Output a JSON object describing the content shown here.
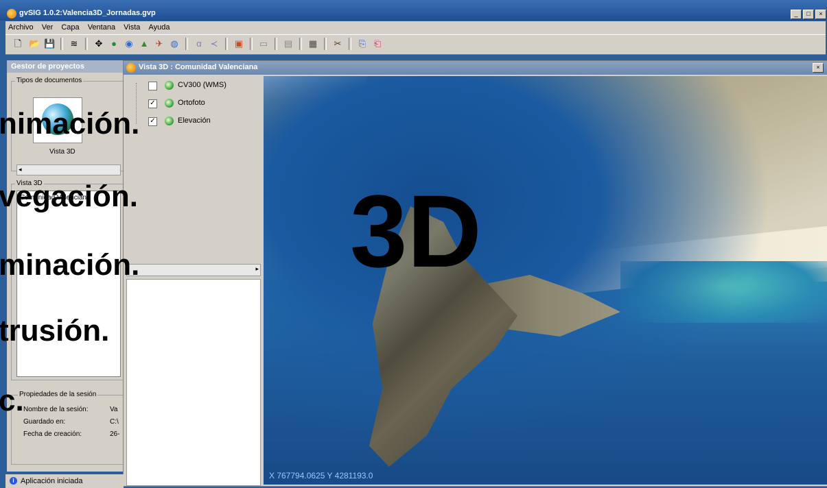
{
  "window": {
    "title": "gvSIG 1.0.2:Valencia3D_Jornadas.gvp",
    "min": "_",
    "max": "□",
    "close": "×"
  },
  "menu": [
    "Archivo",
    "Ver",
    "Capa",
    "Ventana",
    "Vista",
    "Ayuda"
  ],
  "project_manager": {
    "title": "Gestor de proyectos",
    "doc_types_label": "Tipos de documentos",
    "doc_item": "Vista 3D",
    "list_label": "Vista 3D",
    "list_item": "Comunidad Valenciana",
    "session_label": "Propiedades de la sesión",
    "session": [
      {
        "k": "Nombre de la sesión:",
        "v": "Va"
      },
      {
        "k": "Guardado en:",
        "v": "C:\\"
      },
      {
        "k": "Fecha de creación:",
        "v": "26-"
      }
    ]
  },
  "view3d": {
    "title": "Vista 3D : Comunidad Valenciana",
    "close": "×",
    "layers": [
      {
        "label": "CV300 (WMS)",
        "checked": false
      },
      {
        "label": "Ortofoto",
        "checked": true
      },
      {
        "label": "Elevación",
        "checked": true
      }
    ],
    "coords": "X  767794.0625 Y  4281193.0"
  },
  "overlay": {
    "lines": [
      "nimación.",
      "vegación.",
      "minación.",
      "trusión.",
      "c."
    ],
    "big": "3D"
  },
  "status": {
    "text": "Aplicación iniciada",
    "icon": "i"
  }
}
